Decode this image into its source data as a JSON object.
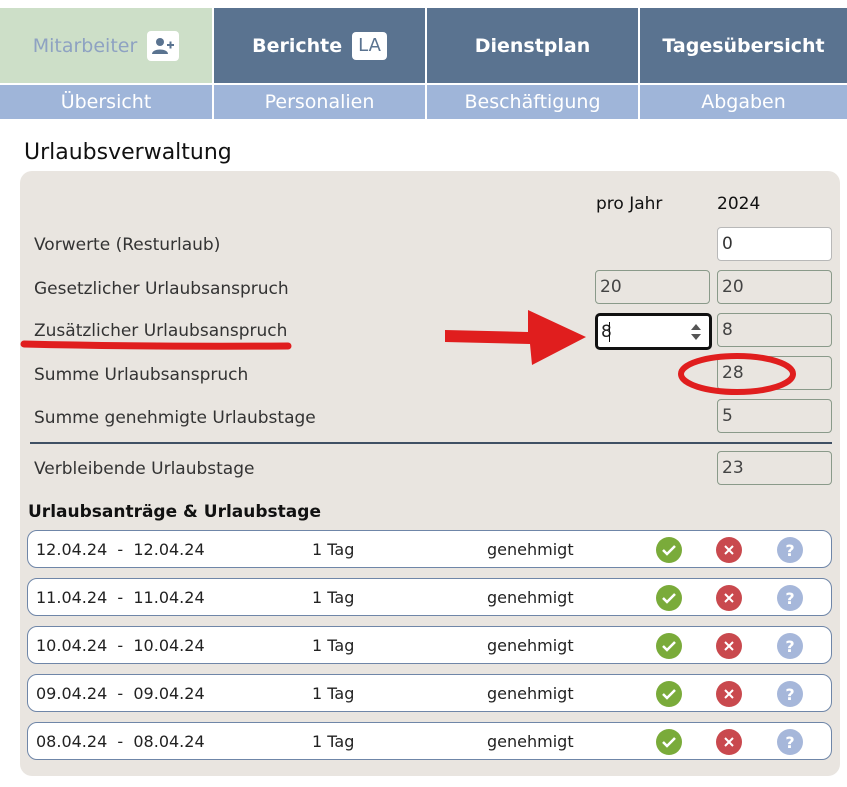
{
  "nav": {
    "tabs": [
      {
        "label": "Mitarbeiter",
        "icon": "user-plus-icon",
        "active": true
      },
      {
        "label": "Berichte",
        "badge": "LA"
      },
      {
        "label": "Dienstplan"
      },
      {
        "label": "Tagesübersicht"
      }
    ],
    "subtabs": [
      "Übersicht",
      "Personalien",
      "Beschäftigung",
      "Abgaben"
    ]
  },
  "page_title": "Urlaubsverwaltung",
  "vacation": {
    "col_per_year": "pro Jahr",
    "col_year": "2024",
    "rows": [
      {
        "label": "Vorwerte (Resturlaub)",
        "year_value": "0"
      },
      {
        "label": "Gesetzlicher Urlaubsanspruch",
        "per_year_value": "20",
        "year_value": "20"
      },
      {
        "label": "Zusätzlicher Urlaubsanspruch",
        "per_year_value": "8",
        "year_value": "8"
      },
      {
        "label": "Summe Urlaubsanspruch",
        "year_value": "28"
      },
      {
        "label": "Summe genehmigte Urlaubstage",
        "year_value": "5"
      }
    ],
    "remaining": {
      "label": "Verbleibende Urlaubstage",
      "year_value": "23"
    }
  },
  "requests": {
    "title": "Urlaubsanträge & Urlaubstage",
    "items": [
      {
        "from": "12.04.24",
        "to": "12.04.24",
        "days": "1 Tag",
        "status": "genehmigt"
      },
      {
        "from": "11.04.24",
        "to": "11.04.24",
        "days": "1 Tag",
        "status": "genehmigt"
      },
      {
        "from": "10.04.24",
        "to": "10.04.24",
        "days": "1 Tag",
        "status": "genehmigt"
      },
      {
        "from": "09.04.24",
        "to": "09.04.24",
        "days": "1 Tag",
        "status": "genehmigt"
      },
      {
        "from": "08.04.24",
        "to": "08.04.24",
        "days": "1 Tag",
        "status": "genehmigt"
      }
    ],
    "date_separator": "-",
    "icons": {
      "approve": "check-icon",
      "reject": "close-icon",
      "help": "question-icon"
    }
  },
  "colors": {
    "nav": "#5a7390",
    "nav_active": "#cddfc8",
    "subnav": "#9fb5d9",
    "panel": "#e9e5e0",
    "approve": "#7aab3a",
    "reject": "#c9494e",
    "help": "#a6b7da",
    "annotation": "#e01e1e"
  }
}
